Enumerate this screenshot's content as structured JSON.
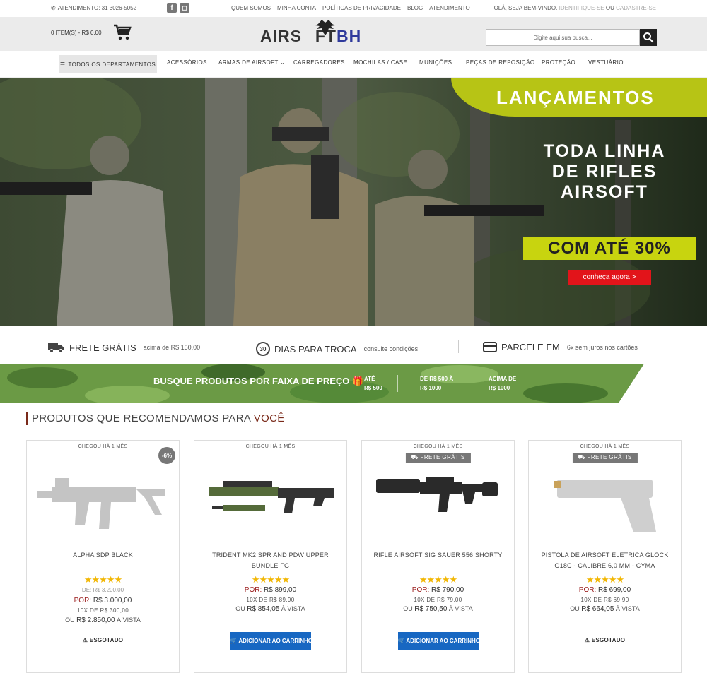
{
  "topbar": {
    "phone": "ATENDIMENTO: 31 3026-5052",
    "links": [
      "QUEM SOMOS",
      "MINHA CONTA",
      "POLÍTICAS DE PRIVACIDADE",
      "BLOG",
      "ATENDIMENTO"
    ],
    "welcome": "OLÁ, SEJA BEM-VINDO.",
    "login": "IDENTIFIQUE-SE",
    "or": "OU",
    "register": "CADASTRE-SE"
  },
  "header": {
    "cart_text": "0 ITEM(S) - R$ 0,00",
    "logo_part1": "AIRS",
    "logo_o": "O",
    "logo_part2": "FT",
    "logo_part3": "BH",
    "search_placeholder": "Digite aqui sua busca..."
  },
  "nav": {
    "departments": "TODOS OS DEPARTAMENTOS",
    "items": [
      "ACESSÓRIOS",
      "ARMAS DE AIRSOFT",
      "CARREGADORES",
      "MOCHILAS / CASE",
      "MUNIÇÕES",
      "PEÇAS DE REPOSIÇÃO",
      "PROTEÇÃO",
      "VESTUÁRIO"
    ]
  },
  "hero": {
    "badge": "LANÇAMENTOS",
    "line1": "TODA LINHA",
    "line2": "DE RIFLES",
    "line3": "AIRSOFT",
    "highlight": "COM ATÉ 30%",
    "cta": "conheça agora >"
  },
  "benefits": [
    {
      "title": "FRETE GRÁTIS",
      "sub": "acima de R$ 150,00"
    },
    {
      "title": "DIAS PARA TROCA",
      "sub": "consulte condições",
      "badge": "30"
    },
    {
      "title": "PARCELE EM",
      "sub": "6x sem juros nos cartões"
    }
  ],
  "price_band": {
    "title": "BUSQUE PRODUTOS POR FAIXA DE PREÇO",
    "ranges": [
      {
        "l1": "ATÉ",
        "l2": "R$ 500"
      },
      {
        "l1": "DE R$ 500 À",
        "l2": "R$ 1000"
      },
      {
        "l1": "ACIMA DE",
        "l2": "R$ 1000"
      }
    ]
  },
  "recommend": {
    "title_main": "PRODUTOS QUE RECOMENDAMOS PARA ",
    "title_accent": "VOCÊ"
  },
  "products": [
    {
      "chegou": "CHEGOU HÁ 1 MÊS",
      "discount": "-6%",
      "name": "ALPHA SDP BLACK",
      "stars": "★★★★★",
      "old_price": "DE: R$ 3.200,00",
      "por_label": "POR:",
      "price": "R$ 3.000,00",
      "installments": "10X DE R$ 300,00",
      "cash_prefix": "OU",
      "cash_price": "R$ 2.850,00",
      "cash_suffix": "À VISTA",
      "status": "ESGOTADO"
    },
    {
      "chegou": "CHEGOU HÁ 1 MÊS",
      "name": "TRIDENT MK2 SPR AND PDW UPPER BUNDLE FG",
      "stars": "★★★★★",
      "por_label": "POR:",
      "price": "R$ 899,00",
      "installments": "10X DE R$ 89,90",
      "cash_prefix": "OU",
      "cash_price": "R$ 854,05",
      "cash_suffix": "À VISTA",
      "button": "ADICIONAR AO CARRINHO"
    },
    {
      "chegou": "CHEGOU HÁ 1 MÊS",
      "frete": "FRETE GRÁTIS",
      "name": "RIFLE AIRSOFT SIG SAUER 556 SHORTY",
      "stars": "★★★★★",
      "por_label": "POR:",
      "price": "R$ 790,00",
      "installments": "10X DE R$ 79,00",
      "cash_prefix": "OU",
      "cash_price": "R$ 750,50",
      "cash_suffix": "À VISTA",
      "button": "ADICIONAR AO CARRINHO"
    },
    {
      "chegou": "CHEGOU HÁ 1 MÊS",
      "frete": "FRETE GRÁTIS",
      "name": "PISTOLA DE AIRSOFT ELETRICA GLOCK G18C - CALIBRE 6,0 MM - CYMA",
      "stars": "★★★★★",
      "por_label": "POR:",
      "price": "R$ 699,00",
      "installments": "10X DE R$ 69,90",
      "cash_prefix": "OU",
      "cash_price": "R$ 664,05",
      "cash_suffix": "À VISTA",
      "status": "ESGOTADO"
    }
  ],
  "colors": {
    "accent_green": "#c8d40f",
    "brand_blue": "#2f3a9c",
    "cta_red": "#e2141a",
    "button_blue": "#1767c2",
    "price_red": "#9b1d1d"
  },
  "icons": [
    "phone-icon",
    "facebook-icon",
    "instagram-icon",
    "cart-icon",
    "search-icon",
    "menu-icon",
    "chevron-down-icon",
    "truck-icon",
    "card-icon",
    "gift-icon",
    "truck-small-icon",
    "warning-icon"
  ]
}
